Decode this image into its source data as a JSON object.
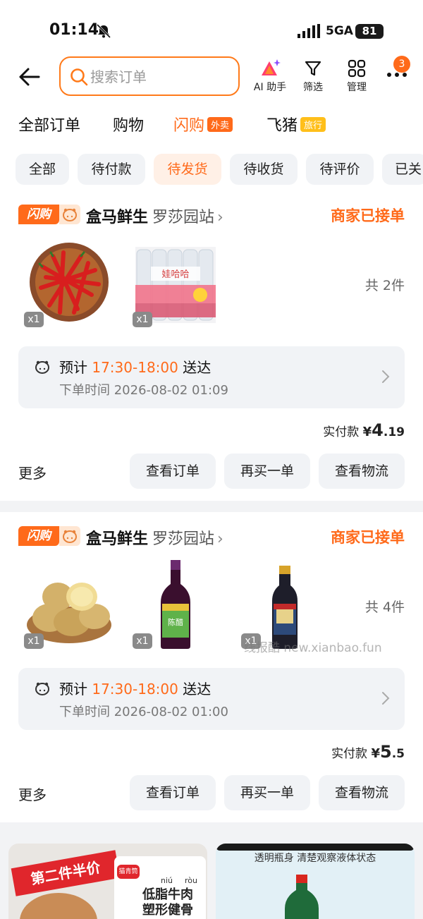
{
  "status_bar": {
    "time": "01:14",
    "network": "5GA",
    "battery": "81"
  },
  "header": {
    "search_placeholder": "搜索订单",
    "ai_label": "AI 助手",
    "filter_label": "筛选",
    "manage_label": "管理",
    "notification_count": "3"
  },
  "tabs": [
    {
      "label": "全部订单",
      "tag": ""
    },
    {
      "label": "购物",
      "tag": ""
    },
    {
      "label": "闪购",
      "tag": "外卖"
    },
    {
      "label": "飞猪",
      "tag": "旅行"
    }
  ],
  "active_tab": "闪购",
  "chips": [
    "全部",
    "待付款",
    "待发货",
    "待收货",
    "待评价",
    "已关"
  ],
  "active_chip": "待发货",
  "orders": [
    {
      "badge": "闪购",
      "store": "盒马鲜生",
      "location": "罗莎园站",
      "state": "商家已接单",
      "items": [
        {
          "name": "chili-peppers",
          "qty": "x1"
        },
        {
          "name": "bottled-water",
          "qty": "x1"
        }
      ],
      "count": "共 2件",
      "eta_prefix": "预计",
      "eta_time": "17:30-18:00",
      "eta_suffix": "送达",
      "order_time": "下单时间 2026-08-02 01:09",
      "paid_label": "实付款",
      "currency": "¥",
      "paid_int": "4",
      "paid_dec": ".19",
      "more": "更多",
      "buttons": [
        "查看订单",
        "再买一单",
        "查看物流"
      ]
    },
    {
      "badge": "闪购",
      "store": "盒马鲜生",
      "location": "罗莎园站",
      "state": "商家已接单",
      "items": [
        {
          "name": "potatoes",
          "qty": "x1"
        },
        {
          "name": "vinegar-bottle",
          "qty": "x1"
        },
        {
          "name": "soy-sauce-bottle",
          "qty": "x1"
        }
      ],
      "count": "共 4件",
      "eta_prefix": "预计",
      "eta_time": "17:30-18:00",
      "eta_suffix": "送达",
      "order_time": "下单时间 2026-08-02 01:00",
      "paid_label": "实付款",
      "currency": "¥",
      "paid_int": "5",
      "paid_dec": ".5",
      "more": "更多",
      "buttons": [
        "查看订单",
        "再买一单",
        "查看物流"
      ]
    }
  ],
  "watermark": "线报酷 new.xianbao.fun",
  "banners": {
    "left": {
      "ribbon": "第二件半价",
      "logo": "猫青筒",
      "product_text": "低脂牛肉 塑形健骨",
      "pinyin_1": "niú",
      "pinyin_2": "ròu"
    },
    "right": {
      "subtitle": "透明瓶身 清楚观察液体状态"
    }
  },
  "colors": {
    "accent": "#ff6a1a",
    "chip_bg": "#f1f3f6",
    "page_bg": "#f2f3f5"
  }
}
